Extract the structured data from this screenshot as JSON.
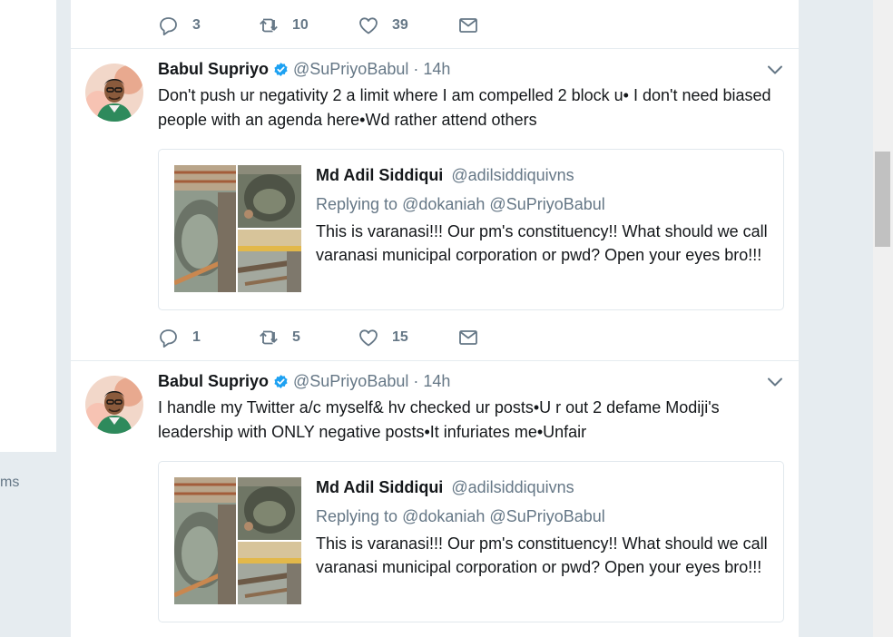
{
  "left_panel": {
    "cut_text": "ms"
  },
  "tweets": [
    {
      "actions": {
        "replies": "3",
        "retweets": "10",
        "likes": "39"
      }
    },
    {
      "author_name": "Babul Supriyo",
      "handle": "@SuPriyoBabul",
      "separator": "·",
      "time": "14h",
      "text": "Don't push ur negativity 2 a limit where I am compelled 2 block u• I don't need biased people with an agenda here•Wd rather attend others",
      "quote": {
        "author_name": "Md Adil Siddiqui",
        "handle": "@adilsiddiquivns",
        "replying_label": "Replying to",
        "mentions": "@dokaniah @SuPriyoBabul",
        "text": "This is varanasi!!! Our pm's constituency!! What should we call varanasi municipal corporation or pwd? Open your eyes bro!!!"
      },
      "actions": {
        "replies": "1",
        "retweets": "5",
        "likes": "15"
      }
    },
    {
      "author_name": "Babul Supriyo",
      "handle": "@SuPriyoBabul",
      "separator": "·",
      "time": "14h",
      "text": "I handle my Twitter a/c myself& hv checked ur posts•U r out 2 defame Modiji's leadership with ONLY negative posts•It infuriates me•Unfair",
      "quote": {
        "author_name": "Md Adil Siddiqui",
        "handle": "@adilsiddiquivns",
        "replying_label": "Replying to",
        "mentions": "@dokaniah @SuPriyoBabul",
        "text": "This is varanasi!!! Our pm's constituency!! What should we call varanasi municipal corporation or pwd? Open your eyes bro!!!"
      }
    }
  ],
  "colors": {
    "background": "#e6ecf0",
    "secondary_text": "#657786",
    "verified": "#1da1f2",
    "border": "#e1e8ed"
  },
  "icons": [
    "reply-icon",
    "retweet-icon",
    "like-icon",
    "direct-message-icon",
    "verified-badge-icon",
    "caret-down-icon"
  ]
}
